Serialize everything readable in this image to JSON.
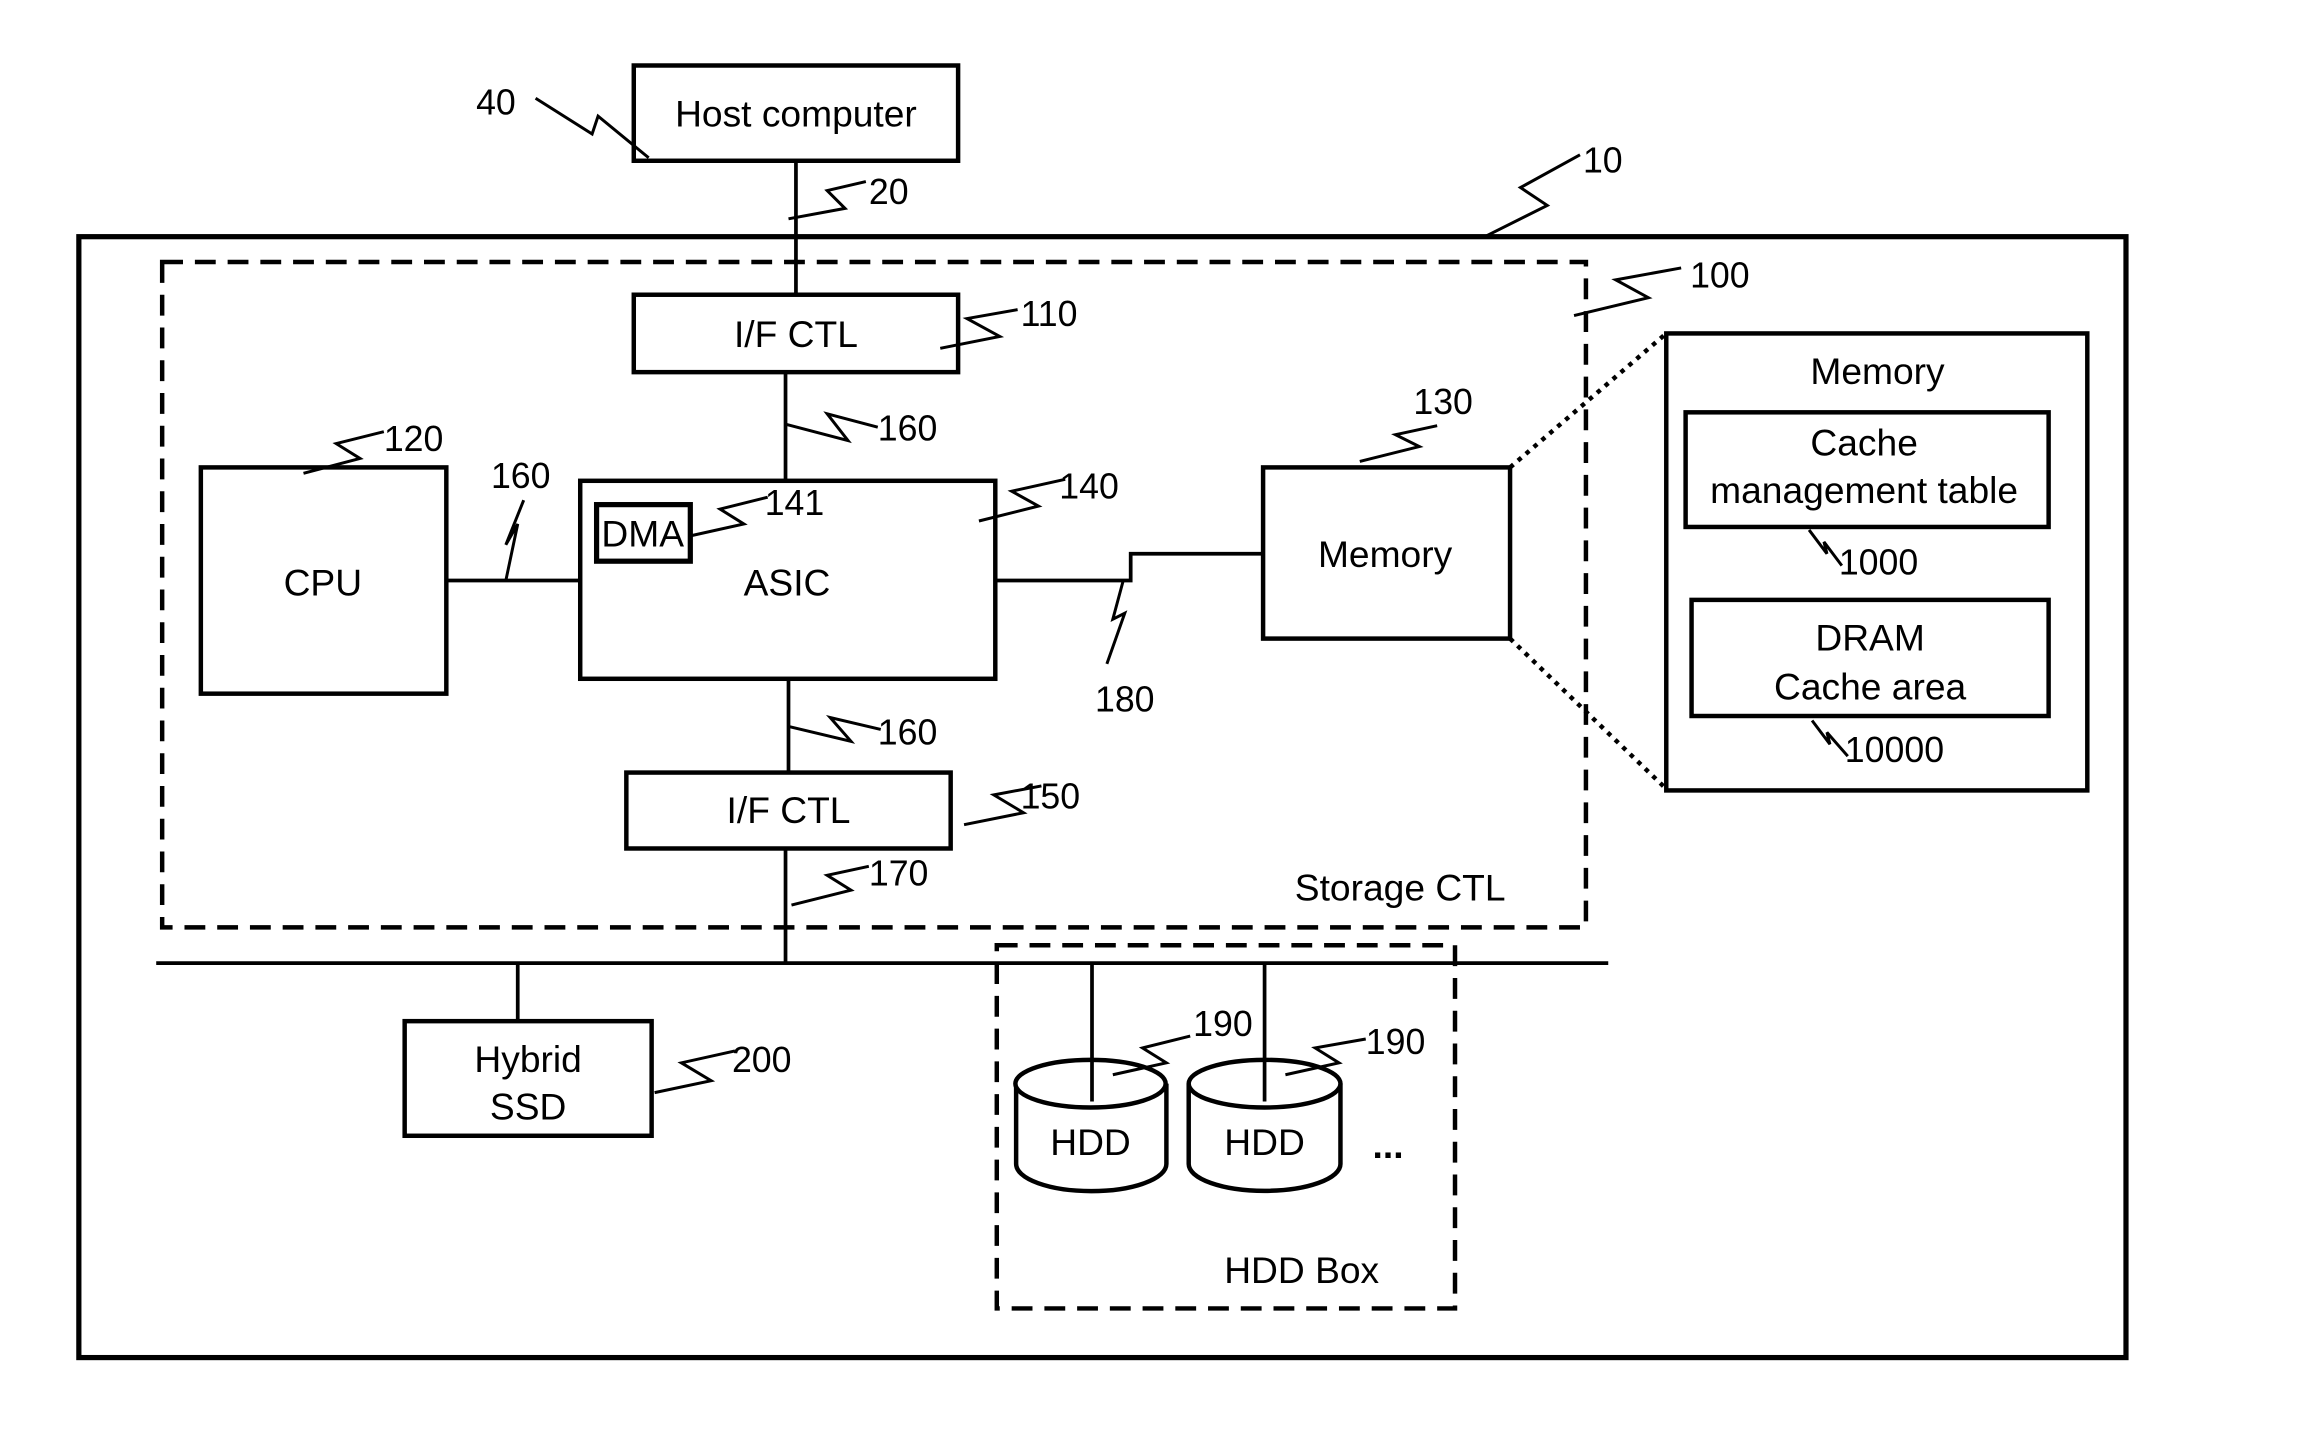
{
  "figure": {
    "type": "storage system block diagram",
    "components": {
      "host": {
        "label": "Host computer",
        "ref": "40"
      },
      "host_link": {
        "ref": "20"
      },
      "storage_system": {
        "ref": "10"
      },
      "storage_ctl": {
        "label": "Storage CTL",
        "ref": "100"
      },
      "if_ctl_top": {
        "label": "I/F CTL",
        "ref": "110"
      },
      "cpu": {
        "label": "CPU",
        "ref": "120"
      },
      "memory": {
        "label": "Memory",
        "ref": "130"
      },
      "asic": {
        "label": "ASIC",
        "ref": "140"
      },
      "dma": {
        "label": "DMA",
        "ref": "141"
      },
      "if_ctl_bottom": {
        "label": "I/F CTL",
        "ref": "150"
      },
      "internal_bus_top": {
        "ref": "160"
      },
      "internal_bus_cpu": {
        "ref": "160"
      },
      "internal_bus_bottom": {
        "ref": "160"
      },
      "backend_link": {
        "ref": "170"
      },
      "memory_link": {
        "ref": "180"
      },
      "hdd_1": {
        "label": "HDD",
        "ref": "190"
      },
      "hdd_2": {
        "label": "HDD",
        "ref": "190"
      },
      "hdd_more": {
        "label": "..."
      },
      "hdd_box": {
        "label": "HDD Box"
      },
      "hybrid_ssd": {
        "line1": "Hybrid",
        "line2": "SSD",
        "ref": "200"
      }
    },
    "memory_detail": {
      "title": "Memory",
      "cache_table": {
        "line1": "Cache",
        "line2": "management table",
        "ref": "1000"
      },
      "dram_cache": {
        "line1": "DRAM",
        "line2": "Cache area",
        "ref": "10000"
      }
    }
  }
}
